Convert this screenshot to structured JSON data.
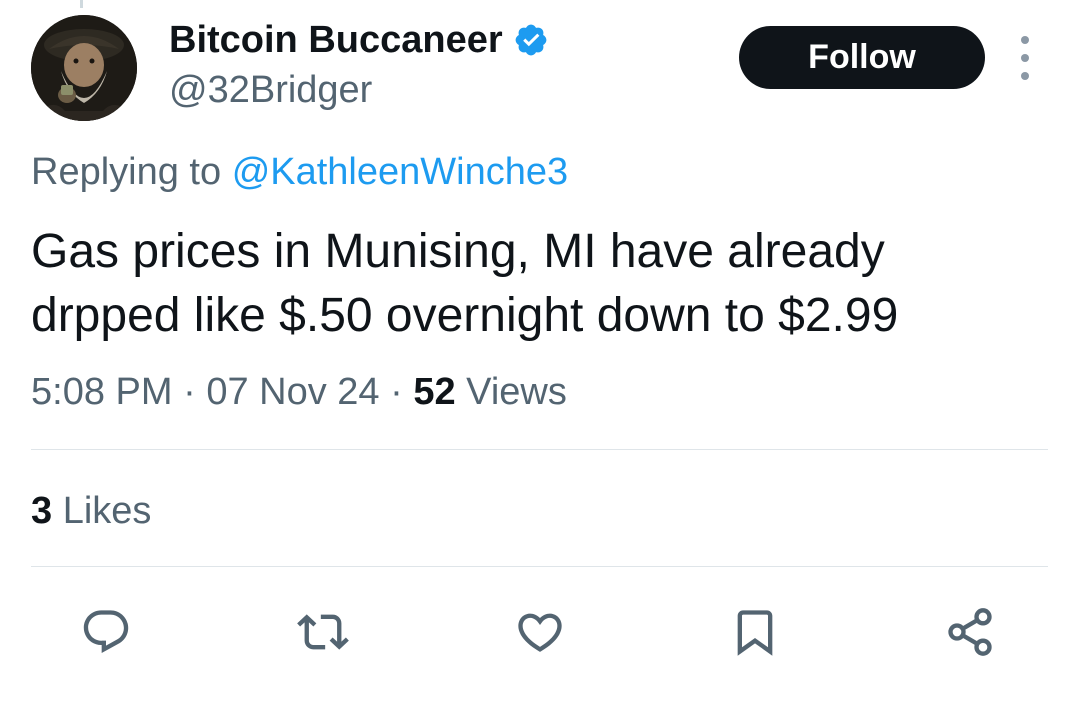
{
  "author": {
    "display_name": "Bitcoin Buccaneer",
    "handle": "@32Bridger",
    "verified": true,
    "avatar_icon": "pirate-avatar"
  },
  "follow_button": {
    "label": "Follow"
  },
  "reply_context": {
    "prefix": "Replying to",
    "mention": "@KathleenWinche3"
  },
  "tweet": {
    "text_lines": [
      "Gas prices in Munising, MI have already",
      "drpped like $.50 overnight down to $2.99"
    ],
    "time": "5:08 PM",
    "date": "07 Nov 24",
    "separator": "·",
    "views_count": "52",
    "views_label": "Views"
  },
  "engagement": {
    "likes_count": "3",
    "likes_label": "Likes"
  },
  "actions": [
    {
      "icon": "reply-icon"
    },
    {
      "icon": "retweet-icon"
    },
    {
      "icon": "like-icon"
    },
    {
      "icon": "bookmark-icon"
    },
    {
      "icon": "share-icon"
    }
  ],
  "colors": {
    "text_primary": "#0f1419",
    "text_secondary": "#536471",
    "accent": "#1d9bf0",
    "verified_badge": "#1d9bf0",
    "follow_bg": "#0f1419",
    "divider": "#dfe5e9"
  }
}
